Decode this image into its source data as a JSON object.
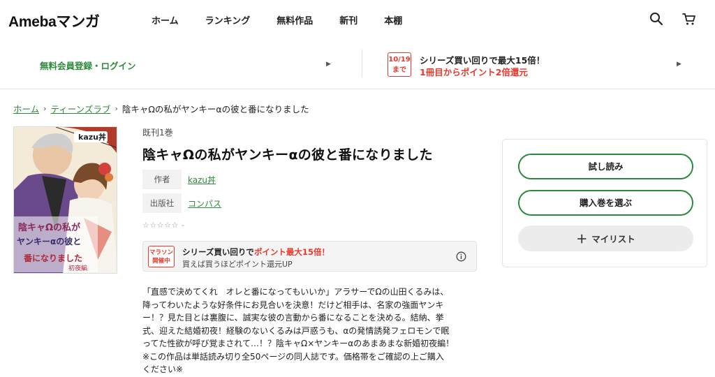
{
  "header": {
    "logo": "Amebaマンガ",
    "nav": [
      "ホーム",
      "ランキング",
      "無料作品",
      "新刊",
      "本棚"
    ],
    "icons": [
      "search-icon",
      "cart-icon"
    ]
  },
  "promo": {
    "left_text": "無料会員登録・ログイン",
    "badge_date": "10/19",
    "badge_until": "まで",
    "right_line1": "シリーズ買い回りで最大15倍！",
    "right_line2": "1冊目からポイント2倍還元"
  },
  "breadcrumb": {
    "home": "ホーム",
    "category": "ティーンズラブ",
    "current": "陰キャΩの私がヤンキーαの彼と番になりました"
  },
  "book": {
    "volumes": "既刊1巻",
    "title": "陰キャΩの私がヤンキーαの彼と番になりました",
    "author_label": "作者",
    "author": "kazu丼",
    "publisher_label": "出版社",
    "publisher": "コンパス",
    "rating_stars": "☆☆☆☆☆",
    "rating_value": "-",
    "cover_title_lines": [
      "陰キャΩの私が",
      "ヤンキーαの彼と",
      "番になりました"
    ],
    "cover_author": "kazu丼",
    "cover_tag": "初夜編"
  },
  "campaign": {
    "badge_line1": "マラソン",
    "badge_line2": "開催中",
    "line1_prefix": "シリーズ買い回りで",
    "line1_highlight": "ポイント最大15倍！",
    "line2": "買えば買うほどポイント還元UP"
  },
  "description": [
    "「直感で決めてくれ　オレと番になってもいいか」アラサーでΩの山田くるみは、",
    "降ってわいたような好条件にお見合いを決意！だけど相手は、名家の強面ヤンキ",
    "ー！？見た目とは裏腹に、誠実な彼の言動から番になることを決める。結納、挙",
    "式、迎えた結婚初夜！経験のないくるみは戸惑うも、αの発情誘発フェロモンで眠",
    "ってた性欲が呼び覚まされて…！？陰キャΩ×ヤンキーαのあまあまな新婚初夜編！",
    "※この作品は単話読み切り全50ページの同人誌です。価格帯をご確認の上ご購入",
    "ください※"
  ],
  "panel": {
    "trial": "試し読み",
    "select_volume": "購入巻を選ぶ",
    "mylist": "マイリスト"
  },
  "colors": {
    "accent_green": "#2d8a3b",
    "accent_red": "#e8392b"
  }
}
